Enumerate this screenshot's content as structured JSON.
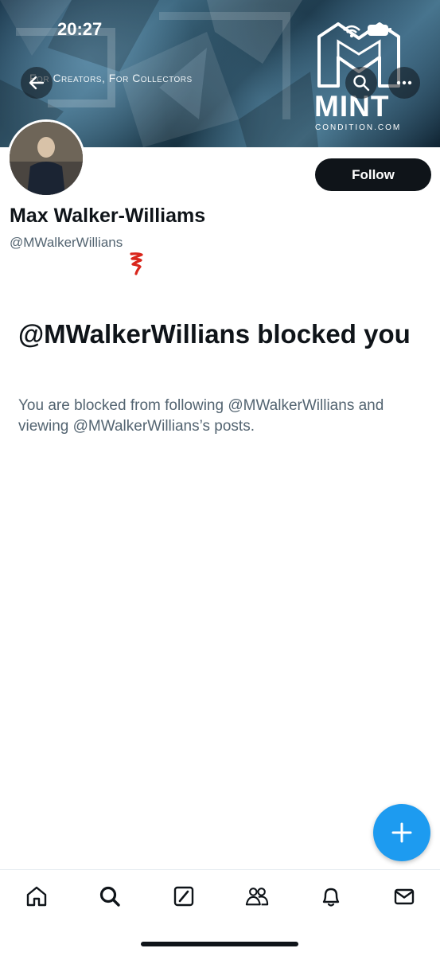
{
  "status_bar": {
    "time": "20:27"
  },
  "banner": {
    "tagline": "For Creators, For Collectors",
    "logo_text": "MINT",
    "logo_subtext": "CONDITION.COM"
  },
  "profile": {
    "display_name": "Max Walker-Williams",
    "handle": "@MWalkerWillians",
    "follow_label": "Follow"
  },
  "blocked": {
    "title": "@MWalkerWillians blocked you",
    "description": "You are blocked from following @MWalkerWillians and viewing @MWalkerWillians’s posts."
  },
  "tabbar": {
    "items": [
      "home-icon",
      "search-icon",
      "grok-icon",
      "communities-icon",
      "notifications-icon",
      "messages-icon"
    ]
  },
  "colors": {
    "accent": "#1d9bf0",
    "primary_text": "#0f1419",
    "secondary_text": "#536471",
    "annotation_red": "#d9261c"
  }
}
